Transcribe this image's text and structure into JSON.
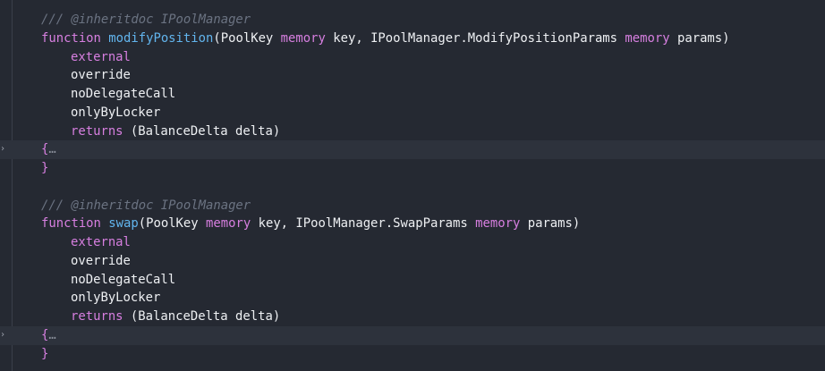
{
  "editor": {
    "blocks": [
      {
        "doc_comment": "/// @inheritdoc IPoolManager",
        "keyword_function": "function",
        "function_name": "modifyPosition",
        "open_paren": "(",
        "param1_type": "PoolKey",
        "param1_location": "memory",
        "param1_name": "key,",
        "param2_type": "IPoolManager.ModifyPositionParams",
        "param2_location": "memory",
        "param2_name": "params",
        "close_paren": ")",
        "modifiers": {
          "external": "external",
          "override": "override",
          "no_delegate_call": "noDelegateCall",
          "only_by_locker": "onlyByLocker"
        },
        "returns_keyword": "returns",
        "returns_open": "(",
        "returns_type": "BalanceDelta",
        "returns_name": "delta",
        "returns_close": ")",
        "folded_open": "{",
        "folded_ellipsis": "…",
        "close_brace": "}"
      },
      {
        "doc_comment": "/// @inheritdoc IPoolManager",
        "keyword_function": "function",
        "function_name": "swap",
        "open_paren": "(",
        "param1_type": "PoolKey",
        "param1_location": "memory",
        "param1_name": "key,",
        "param2_type": "IPoolManager.SwapParams",
        "param2_location": "memory",
        "param2_name": "params",
        "close_paren": ")",
        "modifiers": {
          "external": "external",
          "override": "override",
          "no_delegate_call": "noDelegateCall",
          "only_by_locker": "onlyByLocker"
        },
        "returns_keyword": "returns",
        "returns_open": "(",
        "returns_type": "BalanceDelta",
        "returns_name": "delta",
        "returns_close": ")",
        "folded_open": "{",
        "folded_ellipsis": "…",
        "close_brace": "}"
      }
    ],
    "fold_marker_glyph": "›"
  },
  "colors": {
    "background": "#252932",
    "comment": "#6b7382",
    "keyword": "#d77fe0",
    "function_name": "#62b5ee",
    "text": "#eef0f3"
  }
}
